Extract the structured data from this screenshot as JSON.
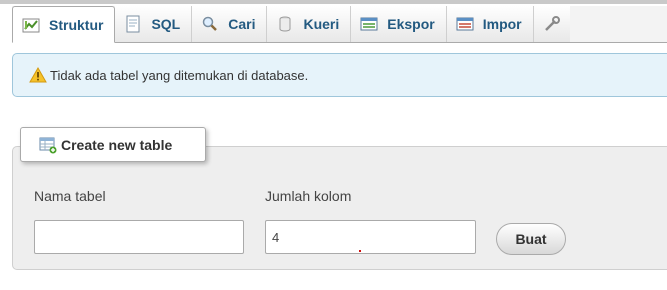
{
  "tabs": [
    {
      "label": "Struktur",
      "icon": "structure-icon",
      "active": true
    },
    {
      "label": "SQL",
      "icon": "sql-icon",
      "active": false
    },
    {
      "label": "Cari",
      "icon": "search-icon",
      "active": false
    },
    {
      "label": "Kueri",
      "icon": "query-icon",
      "active": false
    },
    {
      "label": "Ekspor",
      "icon": "export-icon",
      "active": false
    },
    {
      "label": "Impor",
      "icon": "import-icon",
      "active": false
    }
  ],
  "notice": {
    "text": "Tidak ada tabel yang ditemukan di database.",
    "icon": "warning-icon"
  },
  "create_table": {
    "legend": "Create new table",
    "legend_icon": "new-table-icon",
    "name_label": "Nama tabel",
    "name_value": "",
    "columns_label": "Jumlah kolom",
    "columns_value": "4",
    "submit_label": "Buat"
  },
  "colors": {
    "tab_text": "#235a81",
    "notice_bg": "#e6f3fa",
    "notice_border": "#9fc6db",
    "panel_bg": "#eeeeee"
  }
}
